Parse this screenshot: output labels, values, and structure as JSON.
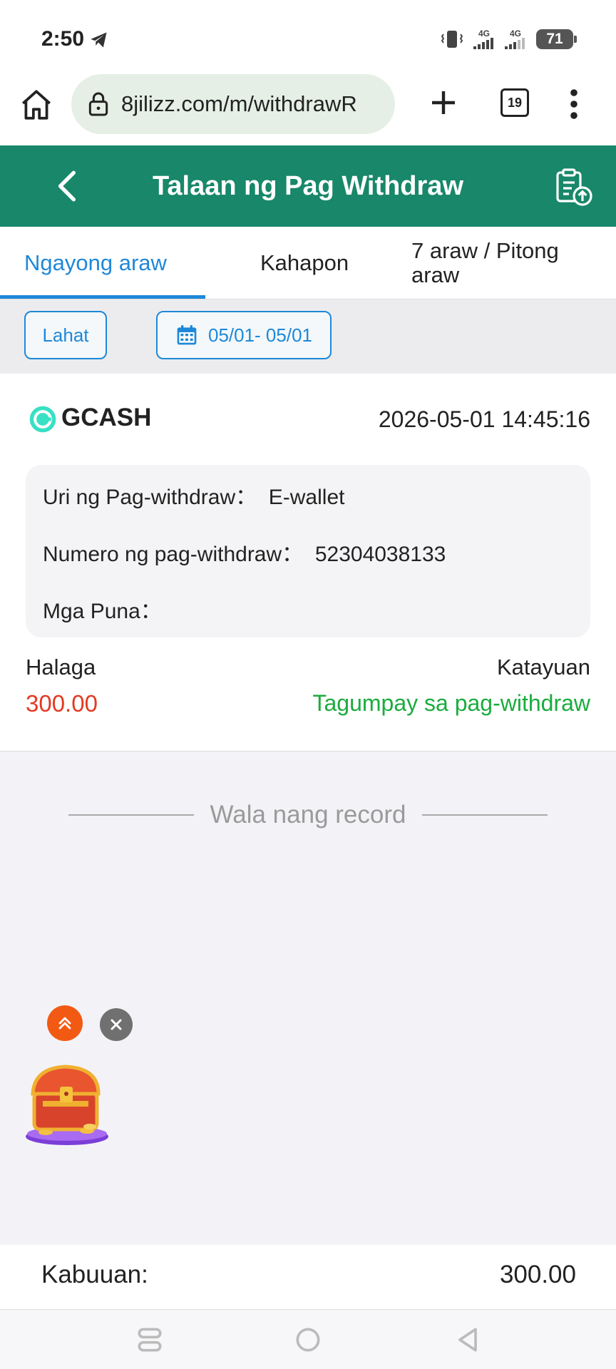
{
  "status_bar": {
    "time": "2:50",
    "network_1": "4G",
    "network_2": "4G",
    "battery": "71"
  },
  "browser": {
    "url": "8jilizz.com/m/withdrawR",
    "tab_count": "19"
  },
  "header": {
    "title": "Talaan ng Pag Withdraw"
  },
  "tabs": [
    {
      "label": "Ngayong araw",
      "active": true
    },
    {
      "label": "Kahapon",
      "active": false
    },
    {
      "label": "7 araw / Pitong araw",
      "active": false
    }
  ],
  "filters": {
    "type_label": "Lahat",
    "date_range": "05/01- 05/01"
  },
  "record": {
    "provider": "GCASH",
    "datetime": "2026-05-01 14:45:16",
    "type_line": "Uri ng Pag-withdraw：  E-wallet",
    "number_line": "Numero ng pag-withdraw：  52304038133",
    "remarks_line": "Mga Puna：",
    "amount_label": "Halaga",
    "amount": "300.00",
    "status_label": "Katayuan",
    "status": "Tagumpay sa pag-withdraw"
  },
  "no_more_records": "Wala nang record",
  "total": {
    "label": "Kabuuan:",
    "value": "300.00"
  },
  "colors": {
    "header_green": "#18876a",
    "active_tab_blue": "#1e88d8",
    "amount_red": "#e33a22",
    "success_green": "#1aac3e"
  }
}
